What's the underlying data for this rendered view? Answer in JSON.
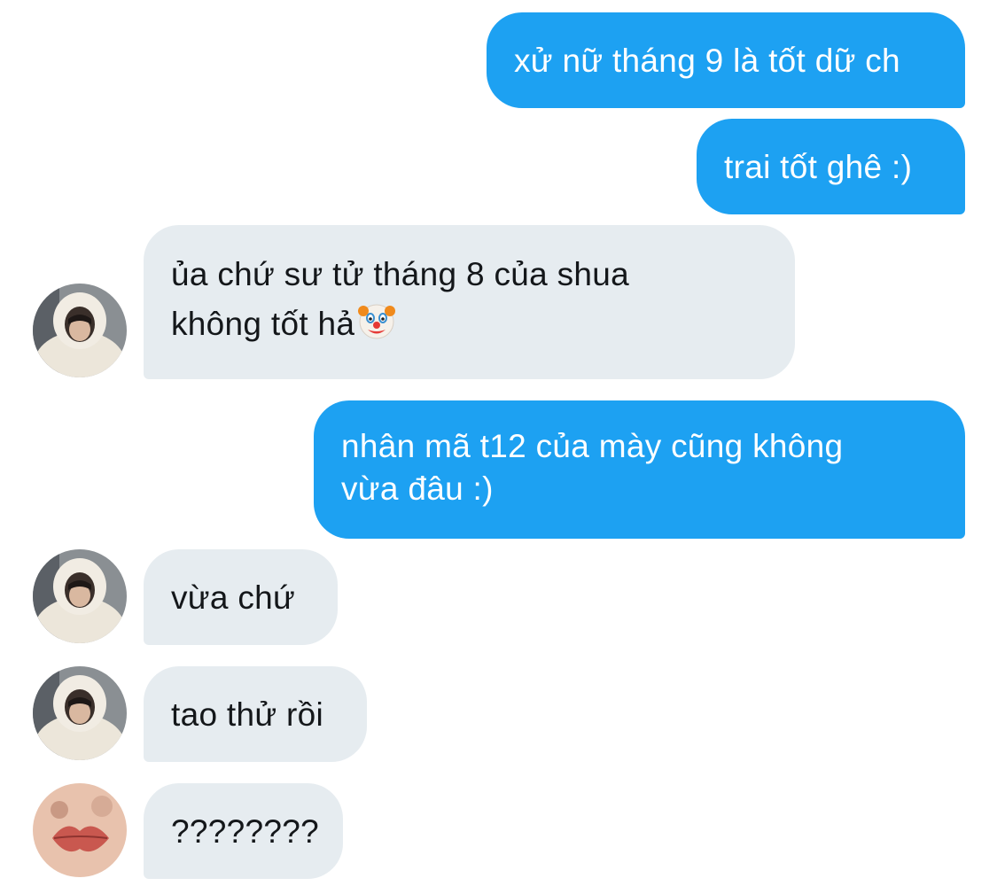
{
  "conversation": {
    "messages": [
      {
        "direction": "outgoing",
        "lines": [
          "xử nữ tháng 9 là tốt dữ ch"
        ]
      },
      {
        "direction": "outgoing",
        "lines": [
          "trai tốt ghê :)"
        ]
      },
      {
        "direction": "incoming",
        "lines": [
          "ủa chứ sư tử tháng 8 của shua",
          "không tốt hả"
        ],
        "emoji": "clown-face-icon",
        "avatar": "hooded-user-avatar"
      },
      {
        "direction": "outgoing",
        "lines": [
          "nhân mã t12 của mày cũng không",
          "vừa đâu :)"
        ]
      },
      {
        "direction": "incoming",
        "lines": [
          "vừa chứ"
        ],
        "avatar": "hooded-user-avatar"
      },
      {
        "direction": "incoming",
        "lines": [
          "tao thử rồi"
        ],
        "avatar": "hooded-user-avatar"
      },
      {
        "direction": "incoming",
        "lines": [
          "????????"
        ],
        "avatar": "lips-user-avatar"
      }
    ]
  },
  "colors": {
    "outgoing_bubble": "#1da1f2",
    "incoming_bubble": "#e6ecf0",
    "outgoing_text": "#ffffff",
    "incoming_text": "#14171a"
  }
}
